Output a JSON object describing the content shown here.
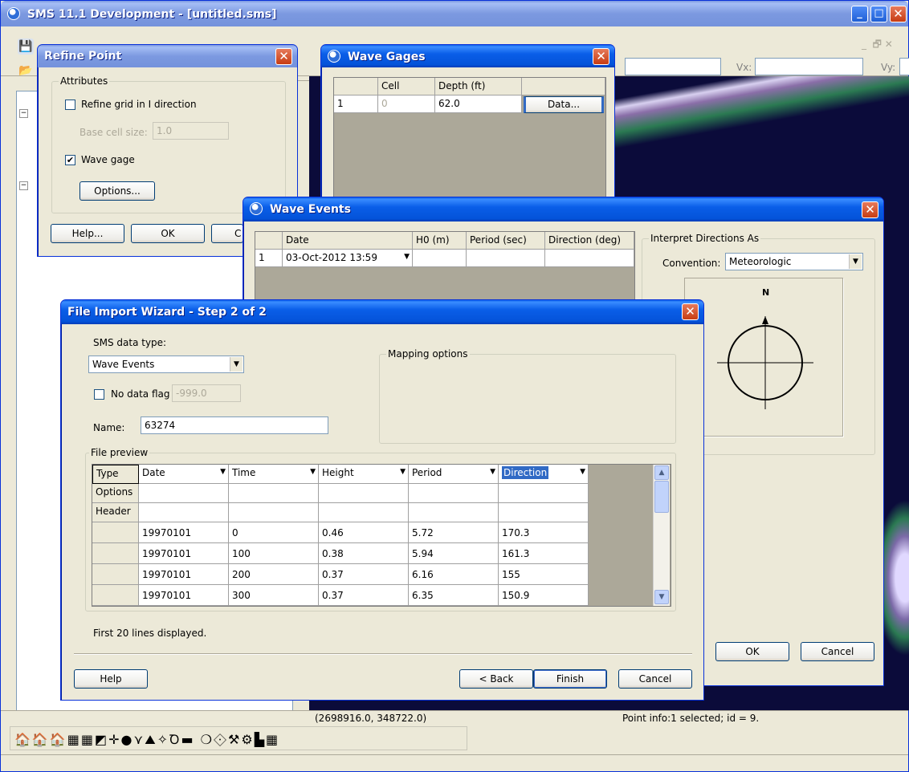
{
  "app": {
    "title": "SMS 11.1 Development - [untitled.sms]",
    "coord_label_vx": "Vx:",
    "coord_label_vy": "Vy:",
    "status_coords": "(2698916.0, 348722.0)",
    "status_info": "Point info:1 selected; id = 9."
  },
  "refine_point": {
    "title": "Refine Point",
    "group_attributes": "Attributes",
    "refine_grid_label": "Refine grid in I direction",
    "refine_grid_checked": false,
    "base_cell_label": "Base cell size:",
    "base_cell_value": "1.0",
    "wave_gage_label": "Wave gage",
    "wave_gage_checked": true,
    "options_button": "Options...",
    "help_button": "Help...",
    "ok_button": "OK",
    "cancel_button_partial": "C"
  },
  "wave_gages": {
    "title": "Wave Gages",
    "columns": [
      "",
      "Cell",
      "Depth (ft)",
      ""
    ],
    "row": {
      "index": "1",
      "cell": "0",
      "depth": "62.0",
      "data_button": "Data..."
    }
  },
  "wave_events": {
    "title": "Wave Events",
    "columns": [
      "",
      "Date",
      "H0 (m)",
      "Period (sec)",
      "Direction (deg)"
    ],
    "row": {
      "index": "1",
      "date": "03-Oct-2012 13:59",
      "h0": "",
      "period": "",
      "direction": ""
    },
    "interpret_group": "Interpret Directions As",
    "convention_label": "Convention:",
    "convention_value": "Meteorologic",
    "north_label": "N",
    "ok_button": "OK",
    "cancel_button": "Cancel"
  },
  "wizard": {
    "title": "File Import Wizard - Step 2 of 2",
    "sms_data_type_label": "SMS data type:",
    "sms_data_type_value": "Wave Events",
    "no_data_flag_label": "No data flag",
    "no_data_flag_checked": false,
    "no_data_flag_value": "-999.0",
    "name_label": "Name:",
    "name_value": "63274",
    "mapping_options": "Mapping options",
    "file_preview": "File preview",
    "row_headers": [
      "Type",
      "Options",
      "Header",
      "",
      "",
      "",
      ""
    ],
    "type_row": [
      "Date",
      "Time",
      "Height",
      "Period",
      "Direction"
    ],
    "data_rows": [
      [
        "19970101",
        "0",
        "0.46",
        "5.72",
        "170.3"
      ],
      [
        "19970101",
        "100",
        "0.38",
        "5.94",
        "161.3"
      ],
      [
        "19970101",
        "200",
        "0.37",
        "6.16",
        "155"
      ],
      [
        "19970101",
        "300",
        "0.37",
        "6.35",
        "150.9"
      ]
    ],
    "lines_note": "First 20 lines displayed.",
    "help_button": "Help",
    "back_button": "< Back",
    "finish_button": "Finish",
    "cancel_button": "Cancel"
  },
  "colors": {
    "xp_title_blue": "#0a5ee8",
    "dialog_face": "#ece9d8",
    "close_red": "#c73c12",
    "map_dark": "#0b0b3a",
    "selection_blue": "#316ac5"
  },
  "icons": [
    "save-icon",
    "open-icon",
    "close-icon",
    "minimize-icon",
    "maximize-icon",
    "dropdown-arrow-icon",
    "scroll-up-icon",
    "scroll-down-icon",
    "compass-icon",
    "toolbar-module-icons"
  ]
}
